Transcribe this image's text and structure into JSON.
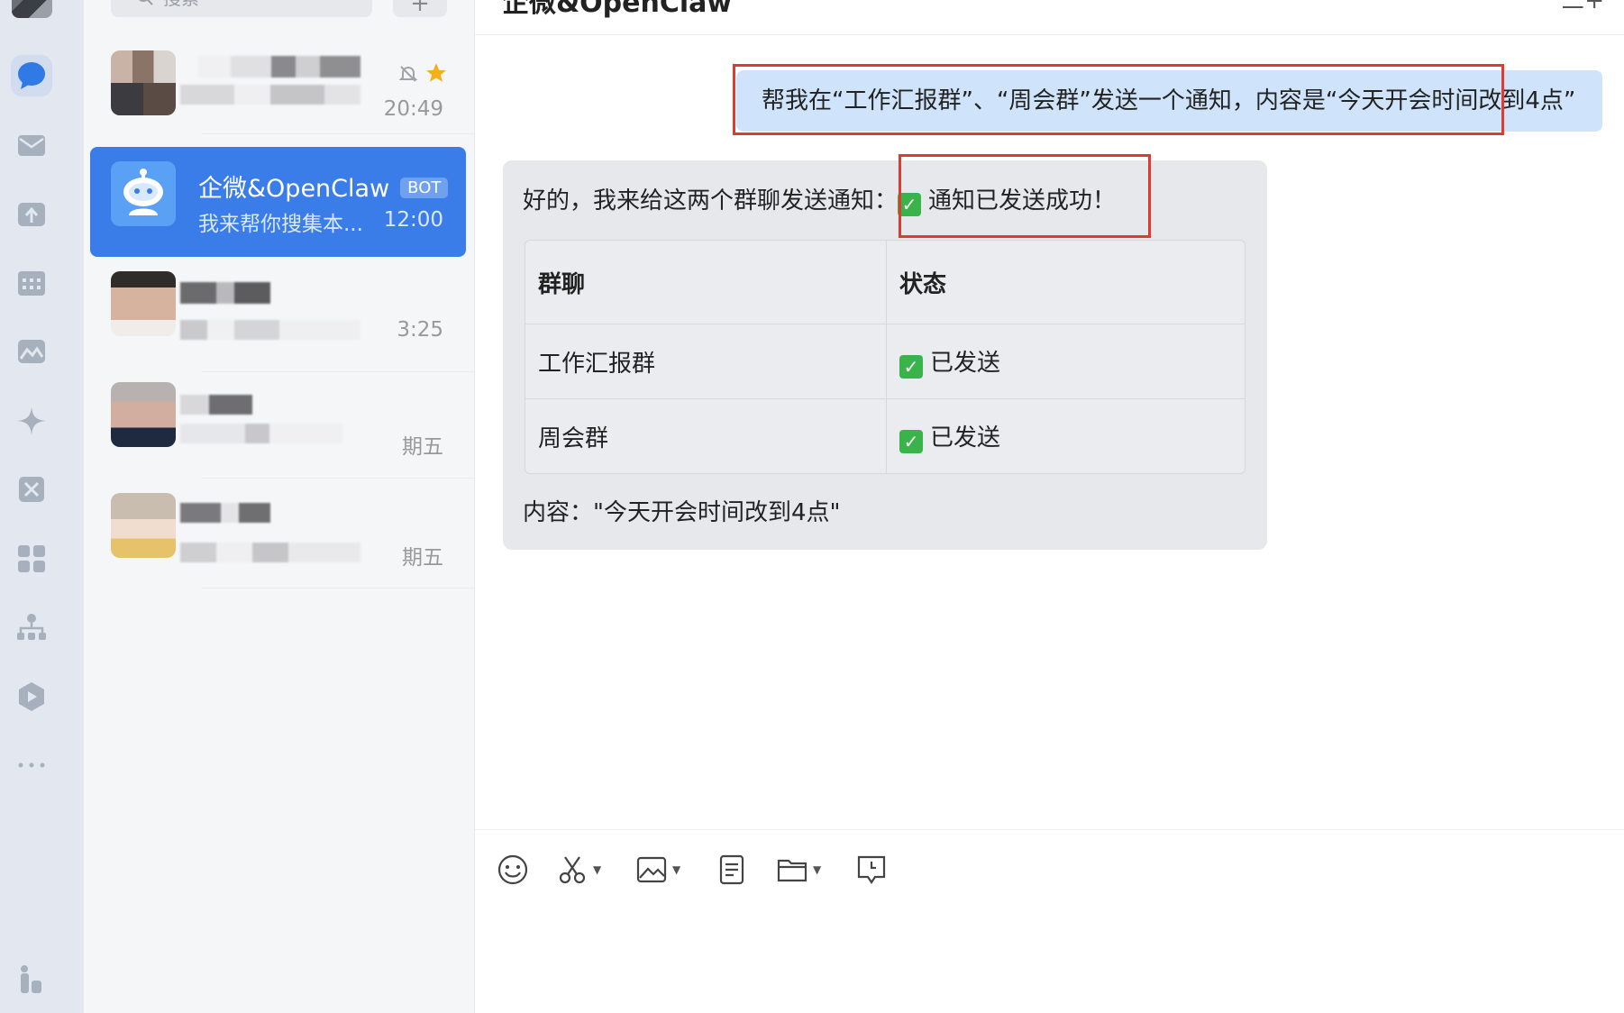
{
  "rail": {
    "items": [
      {
        "name": "chat-icon",
        "active": true
      },
      {
        "name": "mail-icon"
      },
      {
        "name": "workbench-icon"
      },
      {
        "name": "calendar-icon"
      },
      {
        "name": "photos-icon"
      },
      {
        "name": "sparkle-icon"
      },
      {
        "name": "meeting-icon"
      },
      {
        "name": "apps-grid-icon"
      },
      {
        "name": "org-chart-icon"
      },
      {
        "name": "drive-icon"
      },
      {
        "name": "more-icon"
      },
      {
        "name": "stats-icon"
      }
    ]
  },
  "search": {
    "placeholder": "搜索"
  },
  "conversations": [
    {
      "name": "",
      "preview": "",
      "time": "20:49",
      "muted": true,
      "starred": true
    },
    {
      "name": "企微&OpenClaw",
      "badge": "BOT",
      "preview": "我来帮你搜集本...",
      "time": "12:00",
      "active": true
    },
    {
      "name": "",
      "preview": "",
      "time": "3:25"
    },
    {
      "name": "",
      "preview": "",
      "time": "期五"
    },
    {
      "name": "",
      "preview": "",
      "time": "期五"
    }
  ],
  "chat": {
    "title": "企微&OpenClaw",
    "header_right": "三+",
    "user_message": "帮我在“工作汇报群”、“周会群”发送一个通知，内容是“今天开会时间改到4点”",
    "bot_intro": "好的，我来给这两个群聊发送通知：",
    "bot_success": "通知已发送成功！",
    "table": {
      "headers": [
        "群聊",
        "状态"
      ],
      "rows": [
        {
          "group": "工作汇报群",
          "status": "已发送"
        },
        {
          "group": "周会群",
          "status": "已发送"
        }
      ]
    },
    "bot_content": "内容：\"今天开会时间改到4点\""
  },
  "toolbar": {
    "items": [
      "emoji-icon",
      "screenshot-icon",
      "image-icon",
      "document-icon",
      "folder-icon",
      "history-icon"
    ]
  },
  "colors": {
    "accent": "#3a7de8",
    "user_bubble": "#cfe4fa",
    "bot_bubble": "#e7e8ec",
    "highlight_box": "#e23a2e",
    "check": "#39b34a"
  }
}
